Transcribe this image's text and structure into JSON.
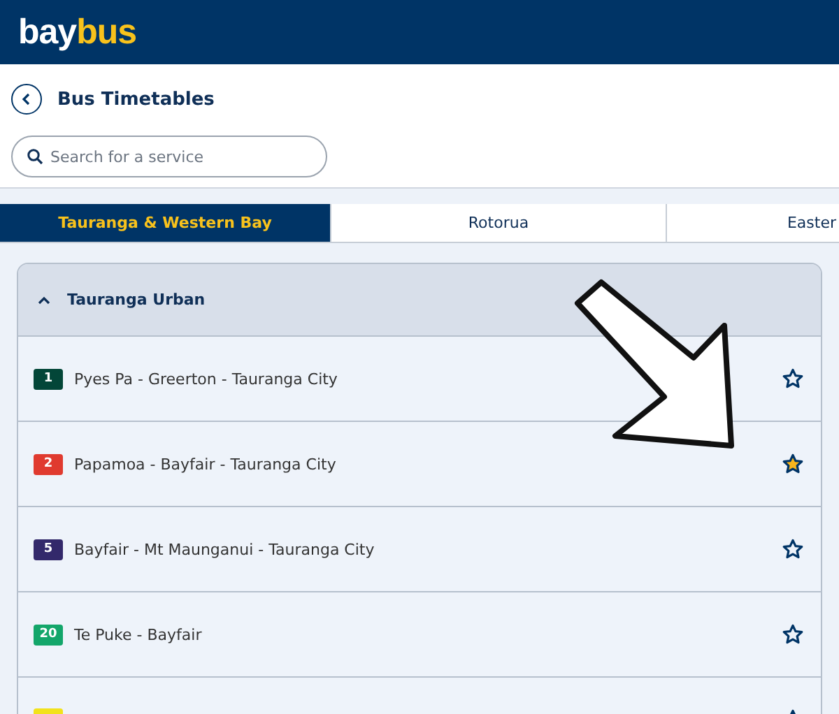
{
  "logo": {
    "first": "bay",
    "second": "bus"
  },
  "page_title": "Bus Timetables",
  "search": {
    "placeholder": "Search for a service"
  },
  "tabs": [
    {
      "label": "Tauranga & Western Bay",
      "selected": true
    },
    {
      "label": "Rotorua",
      "selected": false
    },
    {
      "label": "Easter",
      "selected": false
    }
  ],
  "group": {
    "title": "Tauranga Urban",
    "expanded": true,
    "routes": [
      {
        "number": "1",
        "name": "Pyes Pa - Greerton - Tauranga City",
        "color": "#034638",
        "favourite": false
      },
      {
        "number": "2",
        "name": "Papamoa - Bayfair - Tauranga City",
        "color": "#e03a2f",
        "favourite": true
      },
      {
        "number": "5",
        "name": "Bayfair - Mt Maunganui - Tauranga City",
        "color": "#33296b",
        "favourite": false
      },
      {
        "number": "20",
        "name": "Te Puke - Bayfair",
        "color": "#13a66a",
        "favourite": false
      },
      {
        "color": "#f2e21c"
      }
    ]
  }
}
